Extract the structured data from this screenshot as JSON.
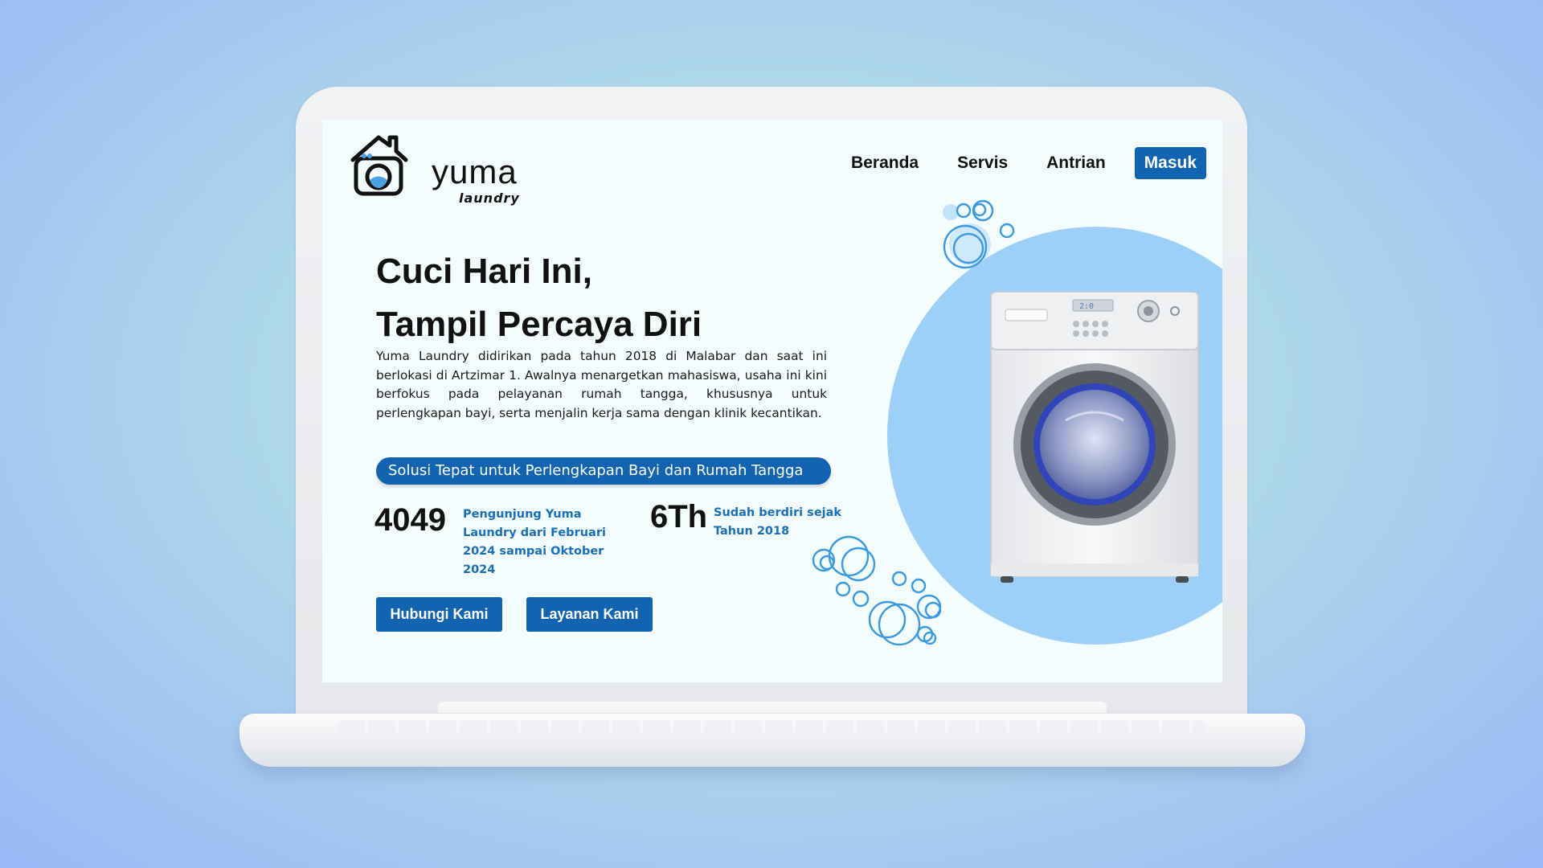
{
  "brand": {
    "name": "yuma",
    "subtitle": "laundry",
    "primary_color": "#1263b0",
    "accent_text_color": "#1a6fb8",
    "bubble_color": "#9dd0f8"
  },
  "nav": {
    "items": [
      {
        "label": "Beranda"
      },
      {
        "label": "Servis"
      },
      {
        "label": "Antrian"
      }
    ],
    "login_label": "Masuk"
  },
  "hero": {
    "headline_line1": "Cuci Hari Ini,",
    "headline_line2": "Tampil Percaya Diri",
    "description": "Yuma Laundry didirikan pada tahun 2018 di Malabar dan saat ini berlokasi di Artzimar 1. Awalnya menargetkan mahasiswa, usaha ini kini berfokus pada pelayanan rumah tangga, khususnya untuk perlengkapan bayi, serta menjalin kerja sama dengan klinik kecantikan.",
    "tagline": "Solusi Tepat untuk Perlengkapan Bayi dan Rumah Tangga"
  },
  "stats": [
    {
      "value": "4049",
      "label": "Pengunjung Yuma Laundry dari Februari 2024 sampai Oktober 2024"
    },
    {
      "value": "6Th",
      "label": "Sudah berdiri sejak Tahun 2018"
    }
  ],
  "actions": {
    "contact_label": "Hubungi Kami",
    "services_label": "Layanan Kami"
  },
  "illustration": {
    "icon": "washing-machine-icon",
    "washer_display": "2:0"
  }
}
